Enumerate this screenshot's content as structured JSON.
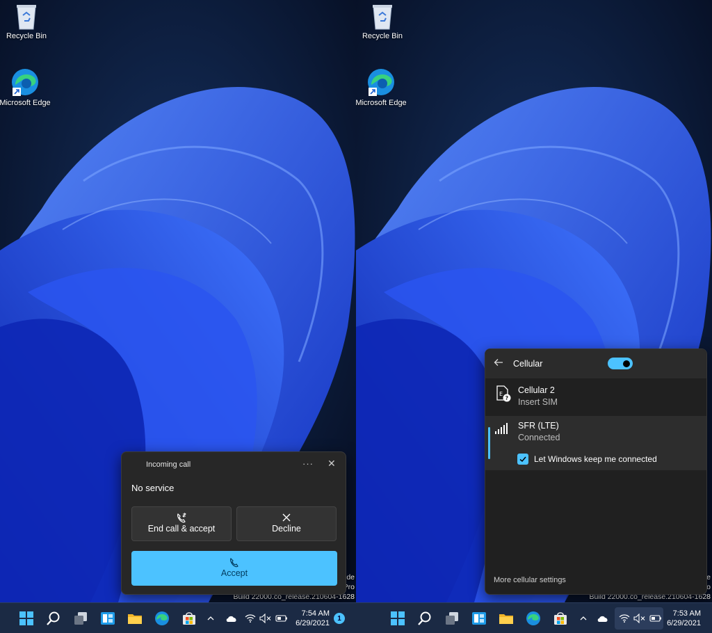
{
  "desktop": {
    "recycle_bin_label": "Recycle Bin",
    "edge_label": "Microsoft Edge"
  },
  "watermark": {
    "build": "Build 22000.co_release.210604-1628",
    "fragment_line1": "de",
    "fragment_line2": "Pro"
  },
  "left_screen": {
    "clock_time": "7:54 AM",
    "clock_date": "6/29/2021",
    "notification_count": "1",
    "toast": {
      "title": "Incoming call",
      "more": "···",
      "close": "✕",
      "status": "No service",
      "end_call_label": "End call & accept",
      "decline_label": "Decline",
      "accept_label": "Accept"
    }
  },
  "right_screen": {
    "clock_time": "7:53 AM",
    "clock_date": "6/29/2021",
    "cellular": {
      "title": "Cellular",
      "toggle_on": true,
      "networks": [
        {
          "name": "Cellular 2",
          "status": "Insert SIM",
          "icon": "sim-card-unknown-icon"
        },
        {
          "name": "SFR (LTE)",
          "status": "Connected",
          "icon": "signal-bars-icon"
        }
      ],
      "keep_connected_label": "Let Windows keep me connected",
      "keep_connected_checked": true,
      "more_settings": "More cellular settings"
    }
  },
  "taskbar_icons": [
    "start-icon",
    "search-icon",
    "task-view-icon",
    "widgets-icon",
    "file-explorer-icon",
    "edge-icon",
    "store-icon"
  ],
  "tray_icons": [
    "chevron-up-icon",
    "onedrive-icon",
    "wifi-icon",
    "volume-muted-icon",
    "battery-icon"
  ],
  "colors": {
    "accent": "#4cc2ff",
    "taskbar": "#1b2a44",
    "flyout_bg": "#202020",
    "toast_bg": "#272727"
  }
}
